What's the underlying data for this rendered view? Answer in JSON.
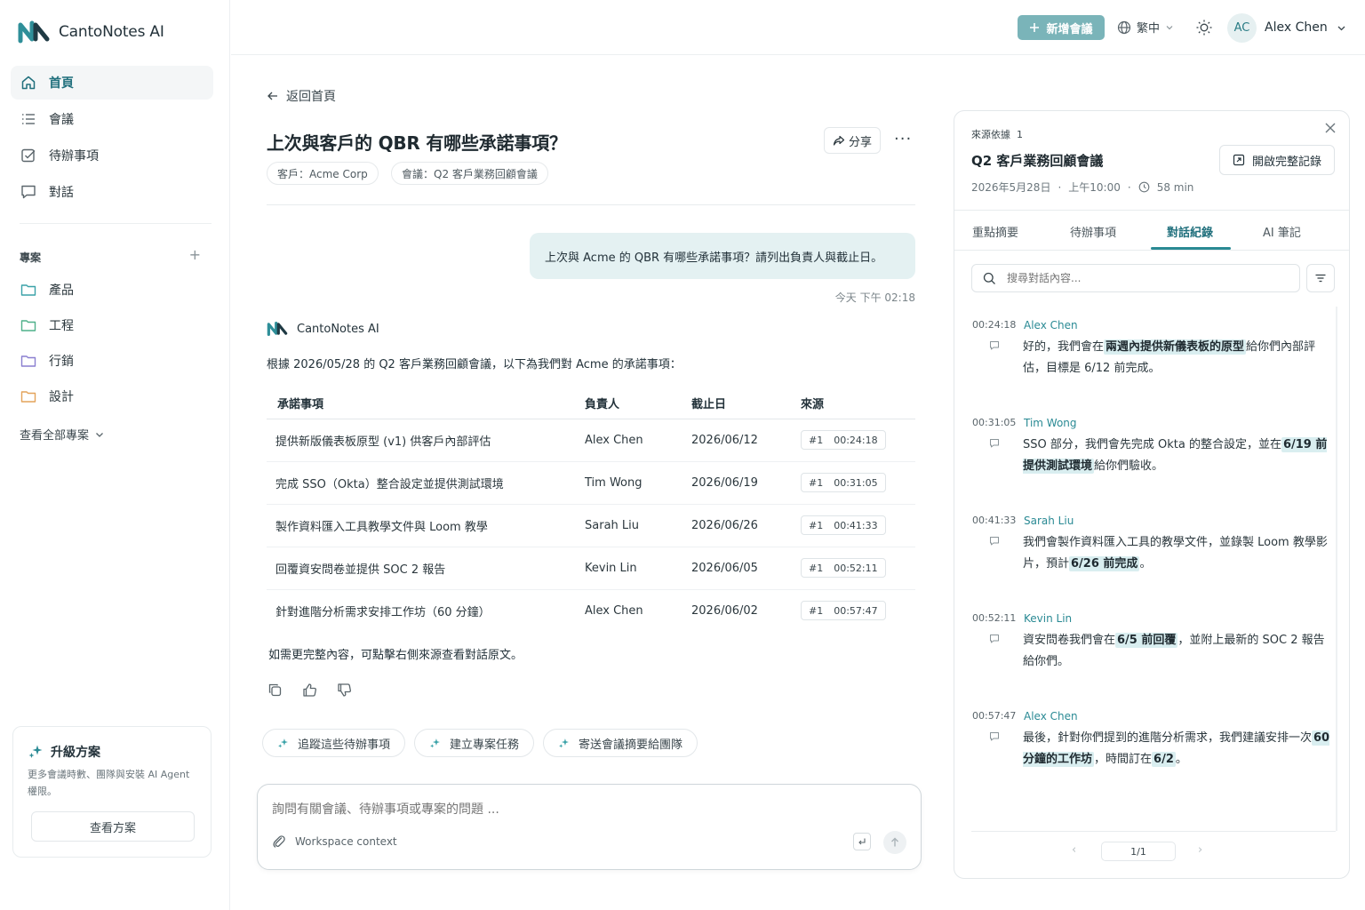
{
  "app": {
    "name": "CantoNotes AI"
  },
  "sidebar": {
    "nav": [
      {
        "label": "首頁",
        "icon": "home-icon",
        "active": true
      },
      {
        "label": "會議",
        "icon": "list-icon",
        "active": false
      },
      {
        "label": "待辦事項",
        "icon": "checkbox-icon",
        "active": false
      },
      {
        "label": "對話",
        "icon": "chat-icon",
        "active": false
      }
    ],
    "projects_title": "專案",
    "add_project": "+",
    "projects": [
      {
        "label": "產品",
        "color": "#3aa2a8"
      },
      {
        "label": "工程",
        "color": "#4fb08a"
      },
      {
        "label": "行銷",
        "color": "#8a7fd0"
      },
      {
        "label": "設計",
        "color": "#e3a35a"
      }
    ],
    "see_all": "查看全部專案",
    "upgrade": {
      "title": "升級方案",
      "desc": "更多會議時數、團隊與安裝 AI Agent 權限。",
      "button": "查看方案"
    }
  },
  "topbar": {
    "new_meeting": "新增會議",
    "language": "繁中",
    "user_initials": "AC",
    "user_name": "Alex Chen",
    "accent": "#7ab4b9"
  },
  "chat": {
    "back": "返回首頁",
    "title": "上次與客戶的 QBR 有哪些承諾事項？",
    "share": "分享",
    "more": "···",
    "tags": [
      "客戶：Acme Corp",
      "會議：Q2 客戶業務回顧會議"
    ],
    "user_message": "上次與 Acme 的 QBR 有哪些承諾事項？請列出負責人與截止日。",
    "message_time": "今天 下午 02:18",
    "ai_name": "CantoNotes AI",
    "ai_intro": "根據 2026/05/28 的 Q2 客戶業務回顧會議，以下為我們對 Acme 的承諾事項：",
    "table": {
      "headers": [
        "承諾事項",
        "負責人",
        "截止日",
        "來源"
      ],
      "rows": [
        {
          "item": "提供新版儀表板原型 (v1) 供客戶內部評估",
          "owner": "Alex Chen",
          "due": "2026/06/12",
          "src_no": "#1",
          "src_time": "00:24:18"
        },
        {
          "item": "完成 SSO（Okta）整合設定並提供測試環境",
          "owner": "Tim Wong",
          "due": "2026/06/19",
          "src_no": "#1",
          "src_time": "00:31:05"
        },
        {
          "item": "製作資料匯入工具教學文件與 Loom 教學",
          "owner": "Sarah Liu",
          "due": "2026/06/26",
          "src_no": "#1",
          "src_time": "00:41:33"
        },
        {
          "item": "回覆資安問卷並提供 SOC 2 報告",
          "owner": "Kevin Lin",
          "due": "2026/06/05",
          "src_no": "#1",
          "src_time": "00:52:11"
        },
        {
          "item": "針對進階分析需求安排工作坊（60 分鐘）",
          "owner": "Alex Chen",
          "due": "2026/06/02",
          "src_no": "#1",
          "src_time": "00:57:47"
        }
      ]
    },
    "ai_outro": "如需更完整內容，可點擊右側來源查看對話原文。",
    "chips": [
      "追蹤這些待辦事項",
      "建立專案任務",
      "寄送會議摘要給團隊"
    ],
    "composer": {
      "placeholder": "詢問有關會議、待辦事項或專案的問題 ...",
      "context": "Workspace context"
    }
  },
  "source_panel": {
    "label": "來源依據",
    "count": "1",
    "title": "Q2 客戶業務回顧會議",
    "date": "2026年5月28日",
    "time": "上午10:00",
    "duration": "58 min",
    "open_full": "開啟完整記錄",
    "tabs": [
      "重點摘要",
      "待辦事項",
      "對話紀錄",
      "AI 筆記"
    ],
    "active_tab": 2,
    "search_placeholder": "搜尋對話內容...",
    "transcript": [
      {
        "time": "00:24:18",
        "speaker": "Alex Chen",
        "before": "好的，我們會在",
        "highlight": "兩週內提供新儀表板的原型",
        "after": "給你們內部評估，目標是 6/12 前完成。"
      },
      {
        "time": "00:31:05",
        "speaker": "Tim Wong",
        "before": "SSO 部分，我們會先完成 Okta 的整合設定，並在",
        "highlight": "6/19 前提供測試環境",
        "after": "給你們驗收。"
      },
      {
        "time": "00:41:33",
        "speaker": "Sarah Liu",
        "before": "我們會製作資料匯入工具的教學文件，並錄製 Loom 教學影片，預計",
        "highlight": "6/26 前完成",
        "after": "。"
      },
      {
        "time": "00:52:11",
        "speaker": "Kevin Lin",
        "before": "資安問卷我們會在",
        "highlight": "6/5 前回覆",
        "after": "，並附上最新的 SOC 2 報告給你們。"
      },
      {
        "time": "00:57:47",
        "speaker": "Alex Chen",
        "before": "最後，針對你們提到的進階分析需求，我們建議安排一次",
        "highlight": "60 分鐘的工作坊",
        "after": "，時間訂在",
        "highlight2": "6/2",
        "after2": "。"
      }
    ],
    "pager": "1/1"
  }
}
